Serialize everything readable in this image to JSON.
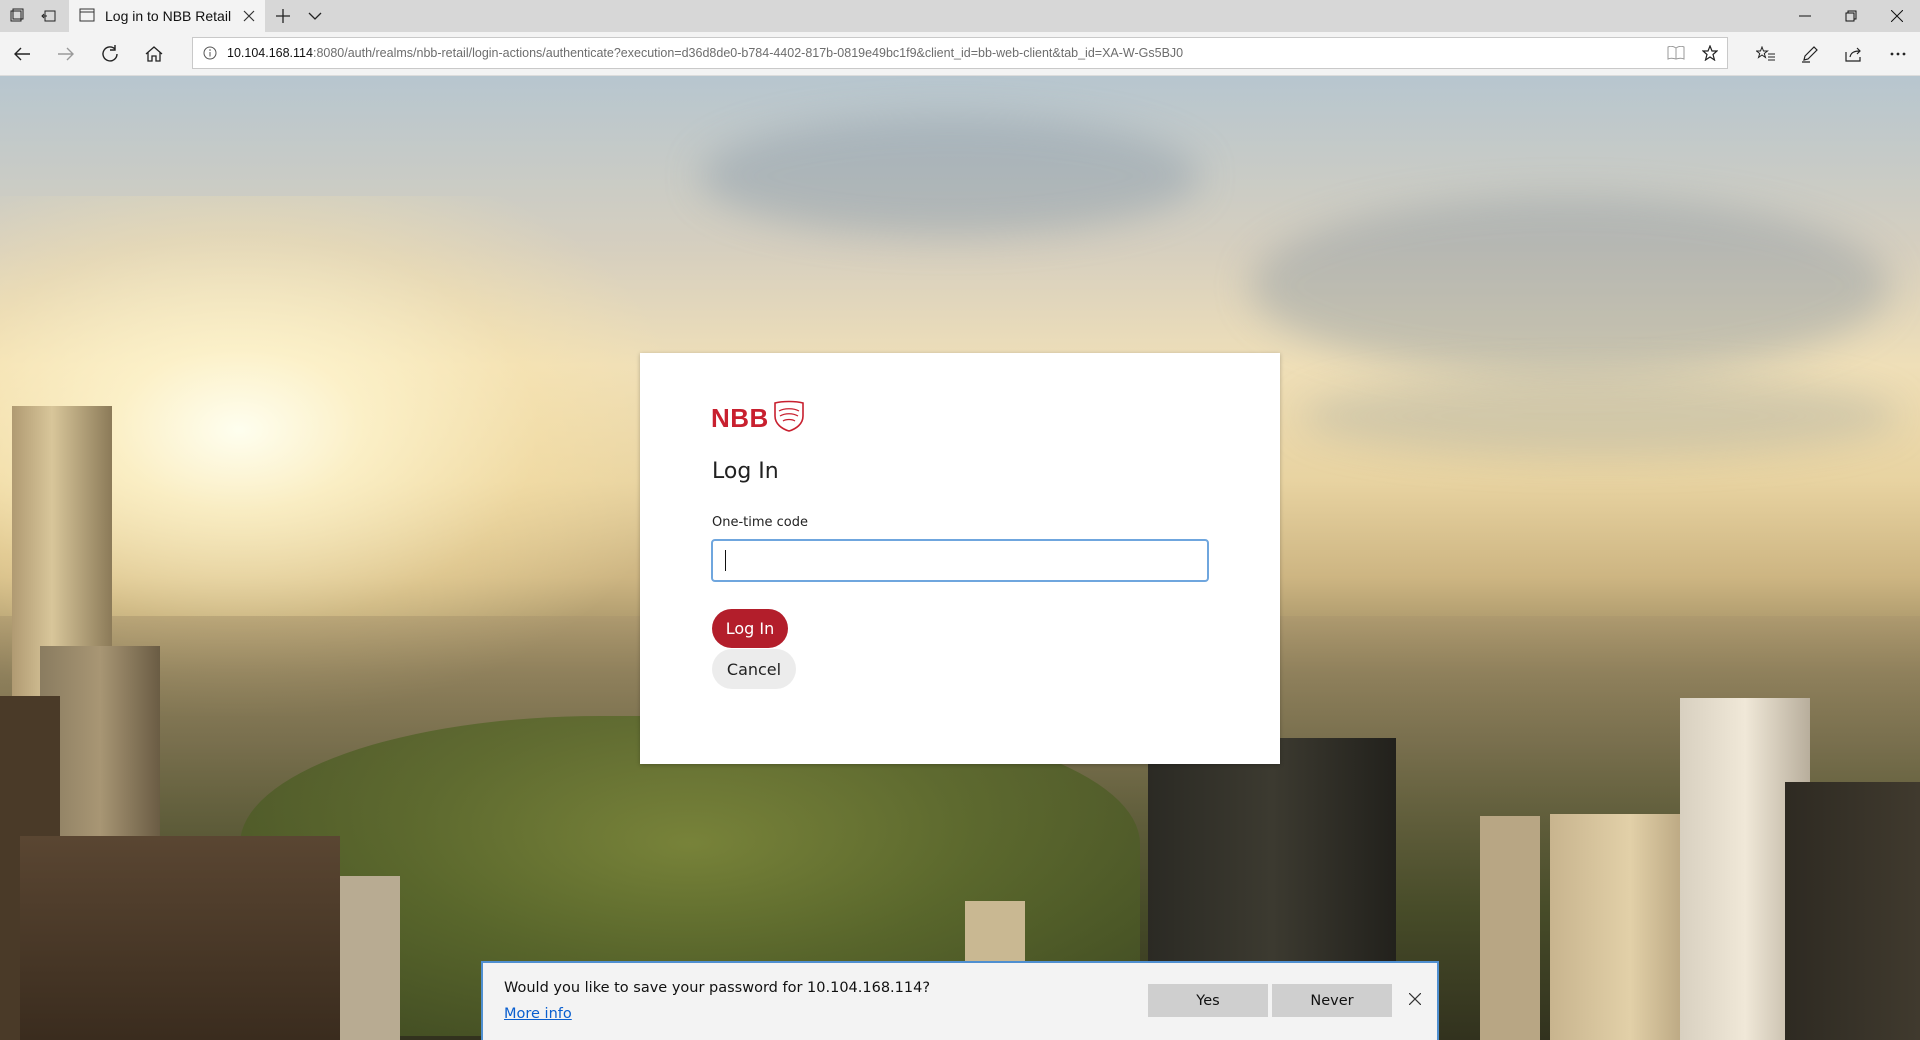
{
  "browser": {
    "tab": {
      "title": "Log in to NBB Retail",
      "icon": "page-icon"
    },
    "address": {
      "host": "10.104.168.114",
      "rest": ":8080/auth/realms/nbb-retail/login-actions/authenticate?execution=d36d8de0-b784-4402-817b-0819e49bc1f9&client_id=bb-web-client&tab_id=XA-W-Gs5BJ0"
    },
    "icons": [
      "tab-list-icon",
      "back-tab-icon",
      "new-tab-icon",
      "tab-dropdown-icon",
      "back-icon",
      "forward-icon",
      "refresh-icon",
      "home-icon",
      "info-icon",
      "reading-view-icon",
      "favorite-star-icon",
      "favorites-hub-icon",
      "pen-icon",
      "share-icon",
      "more-icon",
      "minimize-icon",
      "maximize-icon",
      "close-icon"
    ]
  },
  "login": {
    "logo_text": "NBB",
    "title": "Log In",
    "field_label": "One-time code",
    "code_value": "",
    "login_button": "Log In",
    "cancel_button": "Cancel"
  },
  "password_prompt": {
    "message": "Would you like to save your password for 10.104.168.114?",
    "more_info": "More info",
    "yes": "Yes",
    "never": "Never"
  },
  "colors": {
    "brand_red": "#c8202f",
    "login_button": "#b31e2b",
    "focus_border": "#6fa6de",
    "link_blue": "#0a5fcf"
  }
}
